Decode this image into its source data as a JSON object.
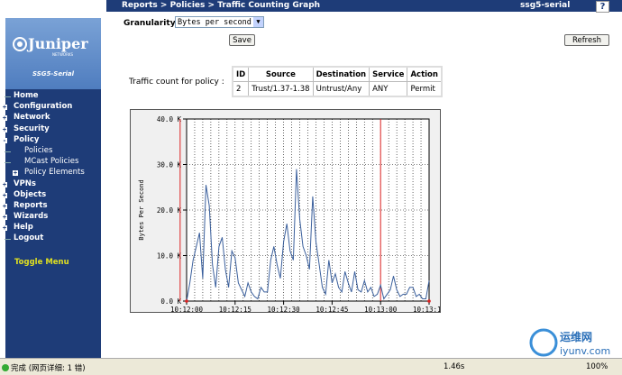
{
  "topbar": {
    "breadcrumb": "Reports > Policies > Traffic Counting Graph",
    "device": "ssg5-serial",
    "help": "?"
  },
  "sidebar": {
    "brand": "Juniper",
    "brand_sub": "NETWORKS",
    "model": "SSG5-Serial",
    "nav": [
      {
        "label": "Home",
        "exp": ""
      },
      {
        "label": "Configuration",
        "exp": "+"
      },
      {
        "label": "Network",
        "exp": "+"
      },
      {
        "label": "Security",
        "exp": "+"
      },
      {
        "label": "Policy",
        "exp": "-"
      },
      {
        "label": "Policies",
        "exp": "",
        "sub": true
      },
      {
        "label": "MCast Policies",
        "exp": "",
        "sub": true
      },
      {
        "label": "Policy Elements",
        "exp": "+",
        "sub": true
      },
      {
        "label": "VPNs",
        "exp": "+"
      },
      {
        "label": "Objects",
        "exp": "+"
      },
      {
        "label": "Reports",
        "exp": "+"
      },
      {
        "label": "Wizards",
        "exp": "+"
      },
      {
        "label": "Help",
        "exp": "+"
      },
      {
        "label": "Logout",
        "exp": ""
      }
    ],
    "toggle": "Toggle Menu"
  },
  "controls": {
    "granularity_label": "Granularity",
    "granularity_value": "Bytes per second",
    "save": "Save",
    "refresh": "Refresh"
  },
  "policy": {
    "label": "Traffic count for policy :",
    "headers": [
      "ID",
      "Source",
      "Destination",
      "Service",
      "Action"
    ],
    "row": [
      "2",
      "Trust/1.37-1.38",
      "Untrust/Any",
      "ANY",
      "Permit"
    ]
  },
  "status": {
    "done": "完成 (网页详细: 1 错)",
    "time": "1.46s",
    "zoom": "100%"
  },
  "watermark": {
    "line1": "运维网",
    "line2": "iyunv.com"
  },
  "chart_data": {
    "type": "line",
    "ylabel": "Bytes Per Second",
    "xlabel": "",
    "yticks": [
      "0.0 K",
      "10.0 K",
      "20.0 K",
      "30.0 K",
      "40.0 K"
    ],
    "ylim": [
      0,
      40000
    ],
    "xticks": [
      "10:12:00",
      "10:12:15",
      "10:12:30",
      "10:12:45",
      "10:13:00",
      "10:13:15"
    ],
    "xlim": [
      0,
      75
    ],
    "grid": true,
    "line_color": "#3a5f9c",
    "marker_color": "#dd2222",
    "markers_x": [
      -2,
      60
    ],
    "series": [
      {
        "x": [
          0,
          1,
          2,
          3,
          4,
          5,
          6,
          7,
          8,
          9,
          10,
          11,
          12,
          13,
          14,
          15,
          16,
          17,
          18,
          19,
          20,
          21,
          22,
          23,
          24,
          25,
          26,
          27,
          28,
          29,
          30,
          31,
          32,
          33,
          34,
          35,
          36,
          37,
          38,
          39,
          40,
          41,
          42,
          43,
          44,
          45,
          46,
          47,
          48,
          49,
          50,
          51,
          52,
          53,
          54,
          55,
          56,
          57,
          58,
          59,
          60,
          61,
          62,
          63,
          64,
          65,
          66,
          67,
          68,
          69,
          70,
          71,
          72,
          73,
          74,
          75
        ],
        "values": [
          0,
          4000,
          9000,
          12000,
          15000,
          5000,
          25500,
          21000,
          8000,
          3000,
          12000,
          14000,
          7000,
          3000,
          11000,
          9500,
          4000,
          2500,
          1000,
          4000,
          2000,
          1000,
          500,
          3000,
          2000,
          2000,
          9000,
          12000,
          8000,
          5000,
          13000,
          17000,
          11000,
          9000,
          29000,
          18000,
          12000,
          10000,
          7000,
          23000,
          13000,
          8000,
          3000,
          1500,
          9000,
          4000,
          6000,
          3000,
          2000,
          6500,
          4000,
          2000,
          6500,
          2500,
          2000,
          4500,
          2000,
          3000,
          1000,
          1500,
          3500,
          500,
          1500,
          2500,
          5500,
          2500,
          1000,
          1500,
          1500,
          3000,
          3000,
          1000,
          1500,
          500,
          500,
          4500
        ]
      }
    ]
  }
}
